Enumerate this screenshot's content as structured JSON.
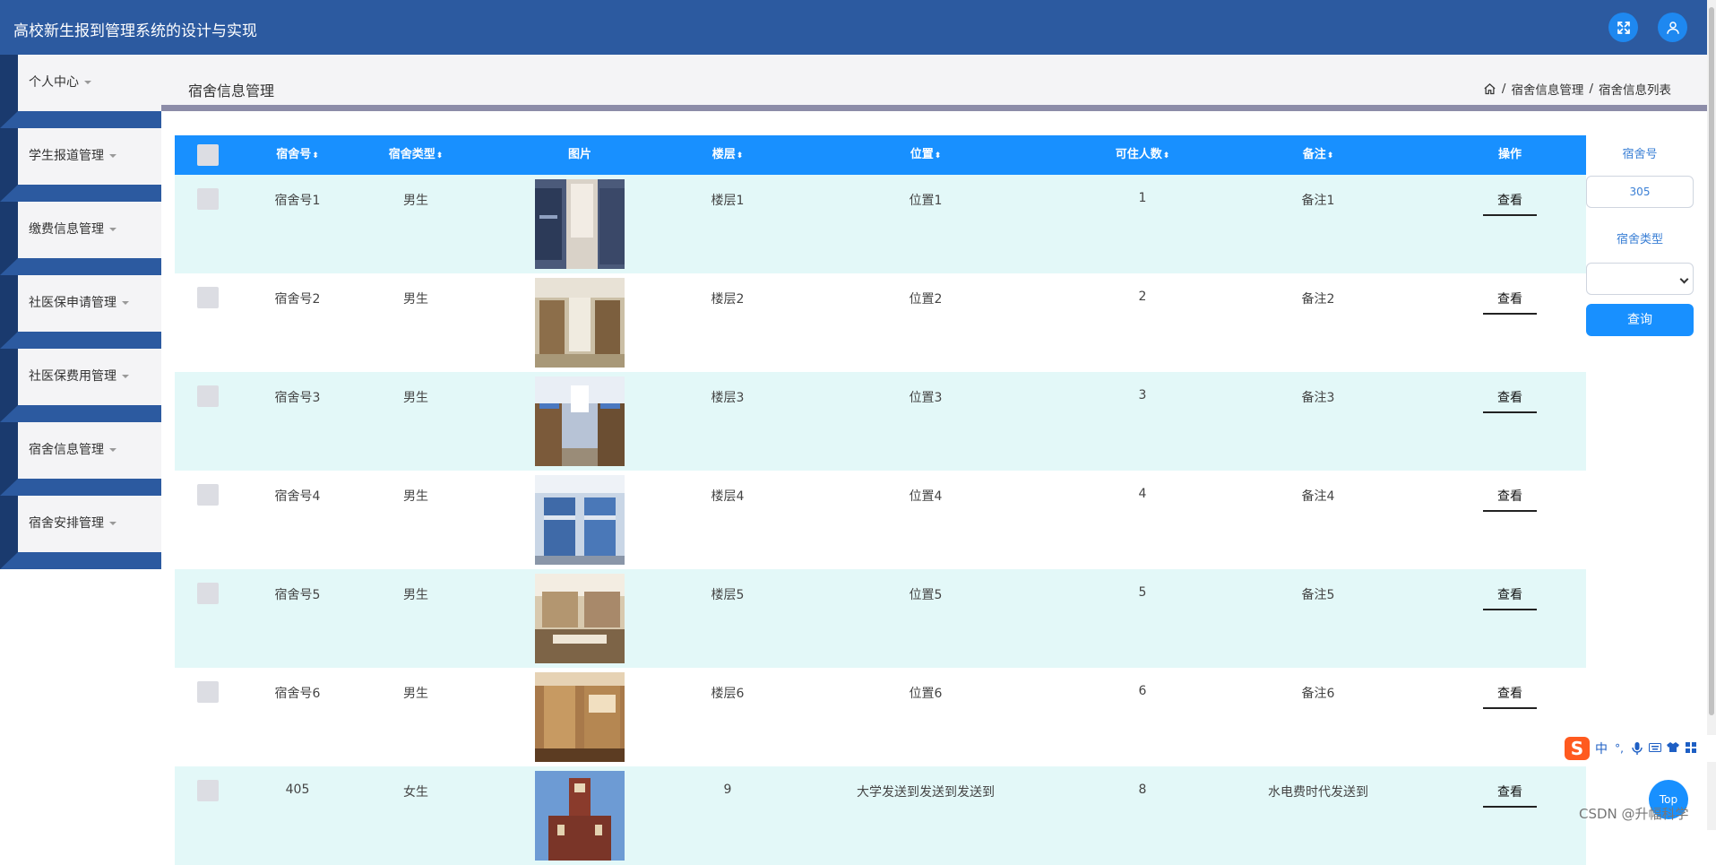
{
  "app": {
    "title": "高校新生报到管理系统的设计与实现"
  },
  "topbar_icons": [
    "fullscreen-icon",
    "user-icon"
  ],
  "sidebar": {
    "items": [
      {
        "label": "个人中心"
      },
      {
        "label": "学生报道管理"
      },
      {
        "label": "缴费信息管理"
      },
      {
        "label": "社医保申请管理"
      },
      {
        "label": "社医保费用管理"
      },
      {
        "label": "宿舍信息管理"
      },
      {
        "label": "宿舍安排管理"
      }
    ]
  },
  "page": {
    "title": "宿舍信息管理",
    "breadcrumb": {
      "sep1": "/",
      "level1": "宿舍信息管理",
      "sep2": "/",
      "level2": "宿舍信息列表"
    }
  },
  "table": {
    "columns": {
      "dorm_no": "宿舍号",
      "dorm_type": "宿舍类型",
      "image": "图片",
      "floor": "楼层",
      "location": "位置",
      "capacity": "可住人数",
      "note": "备注",
      "action": "操作"
    },
    "sort_symbol": "⬍",
    "action_label": "查看",
    "rows": [
      {
        "dorm_no": "宿舍号1",
        "dorm_type": "男生",
        "floor": "楼层1",
        "location": "位置1",
        "capacity": "1",
        "note": "备注1"
      },
      {
        "dorm_no": "宿舍号2",
        "dorm_type": "男生",
        "floor": "楼层2",
        "location": "位置2",
        "capacity": "2",
        "note": "备注2"
      },
      {
        "dorm_no": "宿舍号3",
        "dorm_type": "男生",
        "floor": "楼层3",
        "location": "位置3",
        "capacity": "3",
        "note": "备注3"
      },
      {
        "dorm_no": "宿舍号4",
        "dorm_type": "男生",
        "floor": "楼层4",
        "location": "位置4",
        "capacity": "4",
        "note": "备注4"
      },
      {
        "dorm_no": "宿舍号5",
        "dorm_type": "男生",
        "floor": "楼层5",
        "location": "位置5",
        "capacity": "5",
        "note": "备注5"
      },
      {
        "dorm_no": "宿舍号6",
        "dorm_type": "男生",
        "floor": "楼层6",
        "location": "位置6",
        "capacity": "6",
        "note": "备注6"
      },
      {
        "dorm_no": "405",
        "dorm_type": "女生",
        "floor": "9",
        "location": "大学发送到发送到发送到",
        "capacity": "8",
        "note": "水电费时代发送到"
      }
    ]
  },
  "search": {
    "dorm_no_label": "宿舍号",
    "dorm_no_value": "305",
    "dorm_type_label": "宿舍类型",
    "dorm_type_value": "",
    "button_label": "查询"
  },
  "overlay": {
    "ime_logo": "S",
    "ime_lang": "中",
    "top_button": "Top",
    "watermark": "CSDN @升幅科学"
  },
  "colors": {
    "topbar": "#2c5aa0",
    "accent": "#1890ff",
    "row_alt": "#e3f8f8",
    "sidebar_bg": "#f4f4f6"
  }
}
